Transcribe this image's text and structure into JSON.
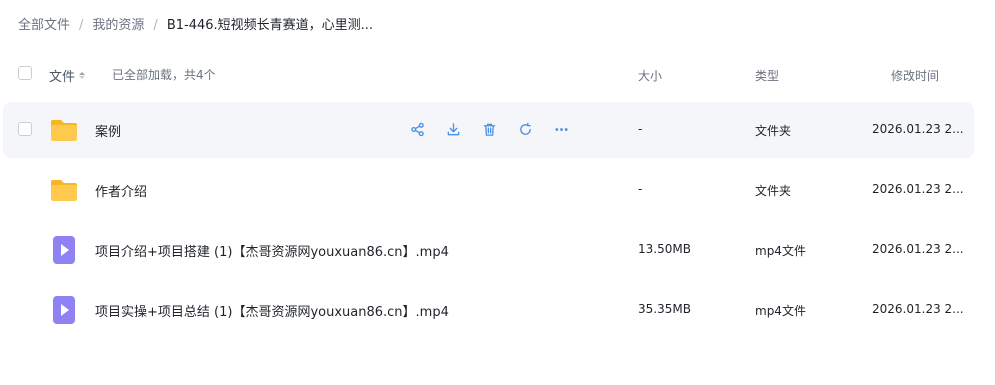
{
  "breadcrumb": {
    "items": [
      "全部文件",
      "我的资源",
      "B1-446.短视频长青赛道，心里测..."
    ],
    "separator": "/"
  },
  "header": {
    "file_label": "文件",
    "loaded_text": "已全部加载，共4个",
    "size_label": "大小",
    "type_label": "类型",
    "time_label": "修改时间"
  },
  "actions": {
    "share": "share-icon",
    "download": "download-icon",
    "delete": "trash-icon",
    "refresh": "refresh-icon",
    "more": "more-icon"
  },
  "colors": {
    "accent": "#4a90e2",
    "folder": "#ffc94d",
    "video": "#8f83f4"
  },
  "files": [
    {
      "name": "案例",
      "size": "-",
      "type": "文件夹",
      "time": "2026.01.23 2...",
      "kind": "folder-icon"
    },
    {
      "name": "作者介绍",
      "size": "-",
      "type": "文件夹",
      "time": "2026.01.23 2...",
      "kind": "folder-icon"
    },
    {
      "name": "项目介绍+项目搭建 (1)【杰哥资源网youxuan86.cn】.mp4",
      "size": "13.50MB",
      "type": "mp4文件",
      "time": "2026.01.23 2...",
      "kind": "video-file-icon"
    },
    {
      "name": "项目实操+项目总结 (1)【杰哥资源网youxuan86.cn】.mp4",
      "size": "35.35MB",
      "type": "mp4文件",
      "time": "2026.01.23 2...",
      "kind": "video-file-icon"
    }
  ]
}
